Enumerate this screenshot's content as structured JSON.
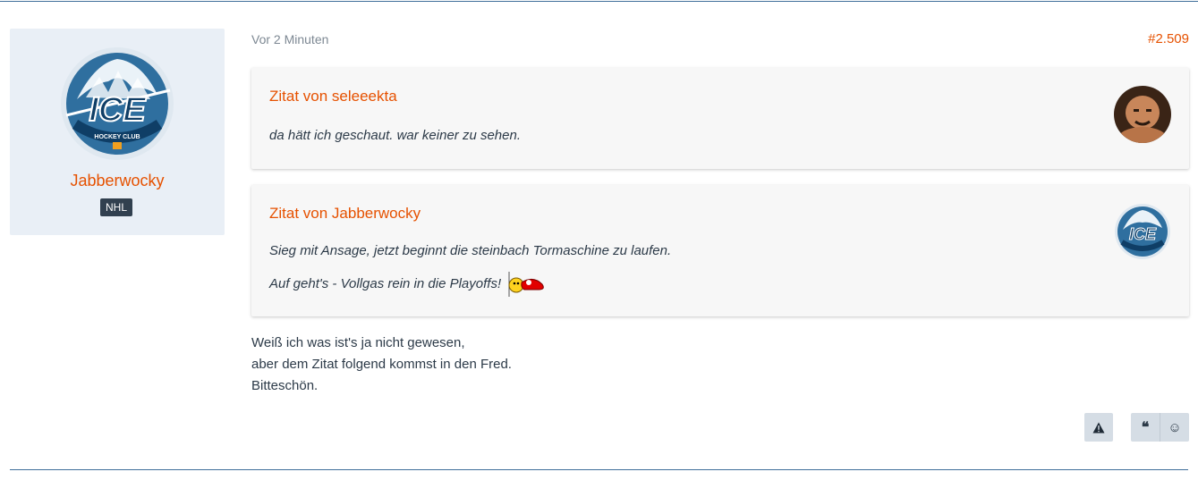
{
  "author": {
    "name": "Jabberwocky",
    "rank": "NHL",
    "avatar_text": "ICE",
    "avatar_subtext": "HOCKEY CLUB"
  },
  "post": {
    "time": "Vor 2 Minuten",
    "number": "#2.509",
    "quotes": [
      {
        "title": "Zitat von seleeekta",
        "lines": [
          "da hätt ich geschaut. war keiner zu sehen."
        ]
      },
      {
        "title": "Zitat von Jabberwocky",
        "lines": [
          "Sieg mit Ansage, jetzt beginnt die steinbach Tormaschine zu laufen.",
          "Auf geht's - Vollgas rein in die Playoffs!"
        ]
      }
    ],
    "message_lines": [
      "Weiß ich was ist's ja nicht gewesen,",
      "aber dem Zitat folgend kommst in den Fred.",
      "Bitteschön."
    ]
  },
  "actions": {
    "report_icon": "warning-icon",
    "quote_icon": "quote-icon",
    "react_icon": "smiley-icon"
  },
  "colors": {
    "accent": "#e65100",
    "sidebar_bg": "#e9eff6",
    "rule": "#3f6e9a",
    "button_bg": "#d5dde5"
  }
}
